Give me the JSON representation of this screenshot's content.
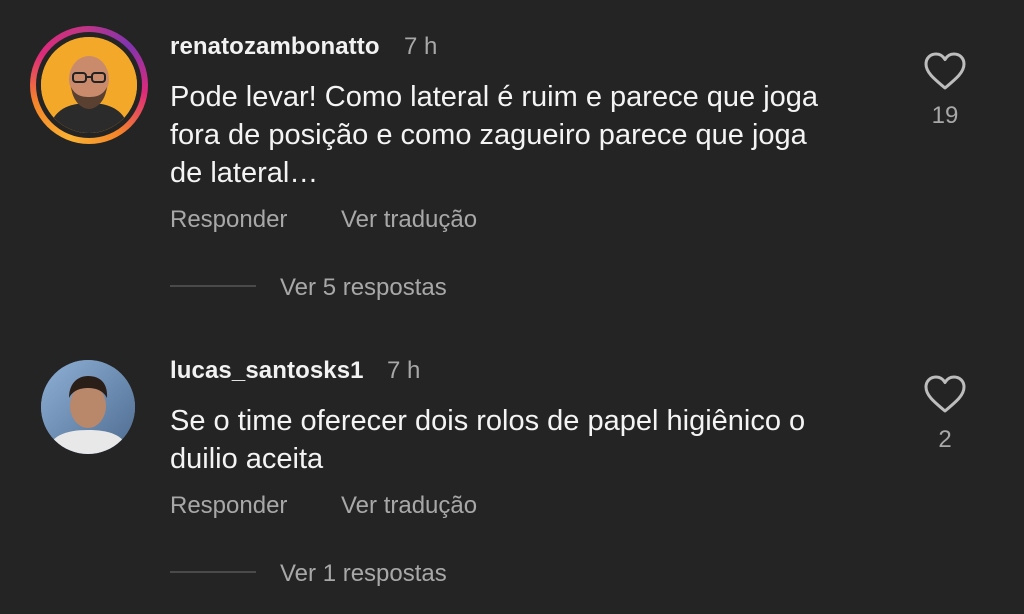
{
  "comments": [
    {
      "username": "renatozambonatto",
      "time": "7 h",
      "text_lines": [
        "Pode levar! Como lateral é ruim e parece que joga",
        "fora de posição e como zagueiro parece que joga",
        "de lateral…"
      ],
      "reply_label": "Responder",
      "translate_label": "Ver tradução",
      "view_replies_label": "Ver 5 respostas",
      "likes": "19",
      "has_story_ring": true
    },
    {
      "username": "lucas_santosks1",
      "time": "7 h",
      "text_lines": [
        "Se o time oferecer dois rolos de papel higiênico o",
        "duilio aceita"
      ],
      "reply_label": "Responder",
      "translate_label": "Ver tradução",
      "view_replies_label": "Ver 1 respostas",
      "likes": "2",
      "has_story_ring": false
    }
  ],
  "icons": {
    "like": "heart-outline-icon"
  },
  "colors": {
    "background": "#242424",
    "primary_text": "#f4f4f4",
    "secondary_text": "#a8a8a8",
    "story_ring": [
      "#f9b233",
      "#dd2a7b",
      "#8134af"
    ]
  }
}
